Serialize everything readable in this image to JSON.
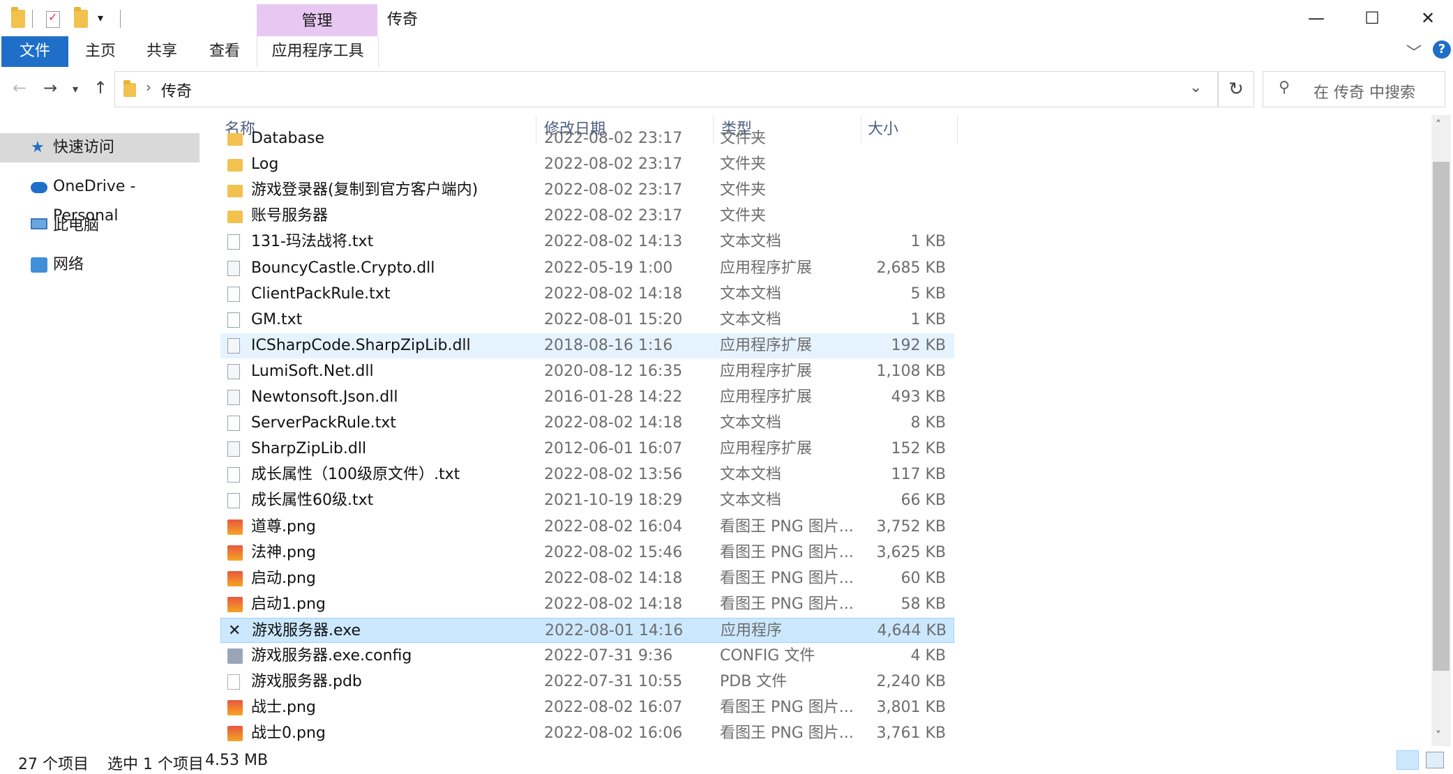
{
  "window": {
    "title": "传奇",
    "manage_tab": "管理",
    "minimize": "—",
    "maximize": "☐",
    "close": "✕"
  },
  "ribbon": {
    "tabs": [
      "文件",
      "主页",
      "共享",
      "查看",
      "应用程序工具"
    ],
    "expand": "﹀",
    "help": "?"
  },
  "address": {
    "path": "传奇",
    "refresh": "↻",
    "search_placeholder": "在 传奇 中搜索"
  },
  "nav": {
    "items": [
      {
        "label": "快速访问",
        "icon": "star-icon"
      },
      {
        "label": "OneDrive - Personal",
        "icon": "cloud-icon"
      },
      {
        "label": "此电脑",
        "icon": "computer-icon"
      },
      {
        "label": "网络",
        "icon": "network-icon"
      }
    ]
  },
  "columns": {
    "name": "名称",
    "date": "修改日期",
    "type": "类型",
    "size": "大小"
  },
  "files": [
    {
      "name": "Database",
      "date": "2022-08-02 23:17",
      "type": "文件夹",
      "size": "",
      "icon": "folder"
    },
    {
      "name": "Log",
      "date": "2022-08-02 23:17",
      "type": "文件夹",
      "size": "",
      "icon": "folder"
    },
    {
      "name": "游戏登录器(复制到官方客户端内)",
      "date": "2022-08-02 23:17",
      "type": "文件夹",
      "size": "",
      "icon": "folder"
    },
    {
      "name": "账号服务器",
      "date": "2022-08-02 23:17",
      "type": "文件夹",
      "size": "",
      "icon": "folder"
    },
    {
      "name": "131-玛法战将.txt",
      "date": "2022-08-02 14:13",
      "type": "文本文档",
      "size": "1 KB",
      "icon": "txt"
    },
    {
      "name": "BouncyCastle.Crypto.dll",
      "date": "2022-05-19 1:00",
      "type": "应用程序扩展",
      "size": "2,685 KB",
      "icon": "dll"
    },
    {
      "name": "ClientPackRule.txt",
      "date": "2022-08-02 14:18",
      "type": "文本文档",
      "size": "5 KB",
      "icon": "txt"
    },
    {
      "name": "GM.txt",
      "date": "2022-08-01 15:20",
      "type": "文本文档",
      "size": "1 KB",
      "icon": "txt"
    },
    {
      "name": "ICSharpCode.SharpZipLib.dll",
      "date": "2018-08-16 1:16",
      "type": "应用程序扩展",
      "size": "192 KB",
      "icon": "dll"
    },
    {
      "name": "LumiSoft.Net.dll",
      "date": "2020-08-12 16:35",
      "type": "应用程序扩展",
      "size": "1,108 KB",
      "icon": "dll"
    },
    {
      "name": "Newtonsoft.Json.dll",
      "date": "2016-01-28 14:22",
      "type": "应用程序扩展",
      "size": "493 KB",
      "icon": "dll"
    },
    {
      "name": "ServerPackRule.txt",
      "date": "2022-08-02 14:18",
      "type": "文本文档",
      "size": "8 KB",
      "icon": "txt"
    },
    {
      "name": "SharpZipLib.dll",
      "date": "2012-06-01 16:07",
      "type": "应用程序扩展",
      "size": "152 KB",
      "icon": "dll"
    },
    {
      "name": "成长属性（100级原文件）.txt",
      "date": "2022-08-02 13:56",
      "type": "文本文档",
      "size": "117 KB",
      "icon": "txt"
    },
    {
      "name": "成长属性60级.txt",
      "date": "2021-10-19 18:29",
      "type": "文本文档",
      "size": "66 KB",
      "icon": "txt"
    },
    {
      "name": "道尊.png",
      "date": "2022-08-02 16:04",
      "type": "看图王 PNG 图片...",
      "size": "3,752 KB",
      "icon": "png"
    },
    {
      "name": "法神.png",
      "date": "2022-08-02 15:46",
      "type": "看图王 PNG 图片...",
      "size": "3,625 KB",
      "icon": "png"
    },
    {
      "name": "启动.png",
      "date": "2022-08-02 14:18",
      "type": "看图王 PNG 图片...",
      "size": "60 KB",
      "icon": "png"
    },
    {
      "name": "启动1.png",
      "date": "2022-08-02 14:18",
      "type": "看图王 PNG 图片...",
      "size": "58 KB",
      "icon": "png"
    },
    {
      "name": "游戏服务器.exe",
      "date": "2022-08-01 14:16",
      "type": "应用程序",
      "size": "4,644 KB",
      "icon": "exe"
    },
    {
      "name": "游戏服务器.exe.config",
      "date": "2022-07-31 9:36",
      "type": "CONFIG 文件",
      "size": "4 KB",
      "icon": "config"
    },
    {
      "name": "游戏服务器.pdb",
      "date": "2022-07-31 10:55",
      "type": "PDB 文件",
      "size": "2,240 KB",
      "icon": "pdb"
    },
    {
      "name": "战士.png",
      "date": "2022-08-02 16:07",
      "type": "看图王 PNG 图片...",
      "size": "3,801 KB",
      "icon": "png"
    },
    {
      "name": "战士0.png",
      "date": "2022-08-02 16:06",
      "type": "看图王 PNG 图片...",
      "size": "3,761 KB",
      "icon": "png"
    }
  ],
  "hover_index": 8,
  "selected_index": 19,
  "status": {
    "count": "27 个项目",
    "selection": "选中 1 个项目",
    "selection_size": "4.53 MB"
  }
}
